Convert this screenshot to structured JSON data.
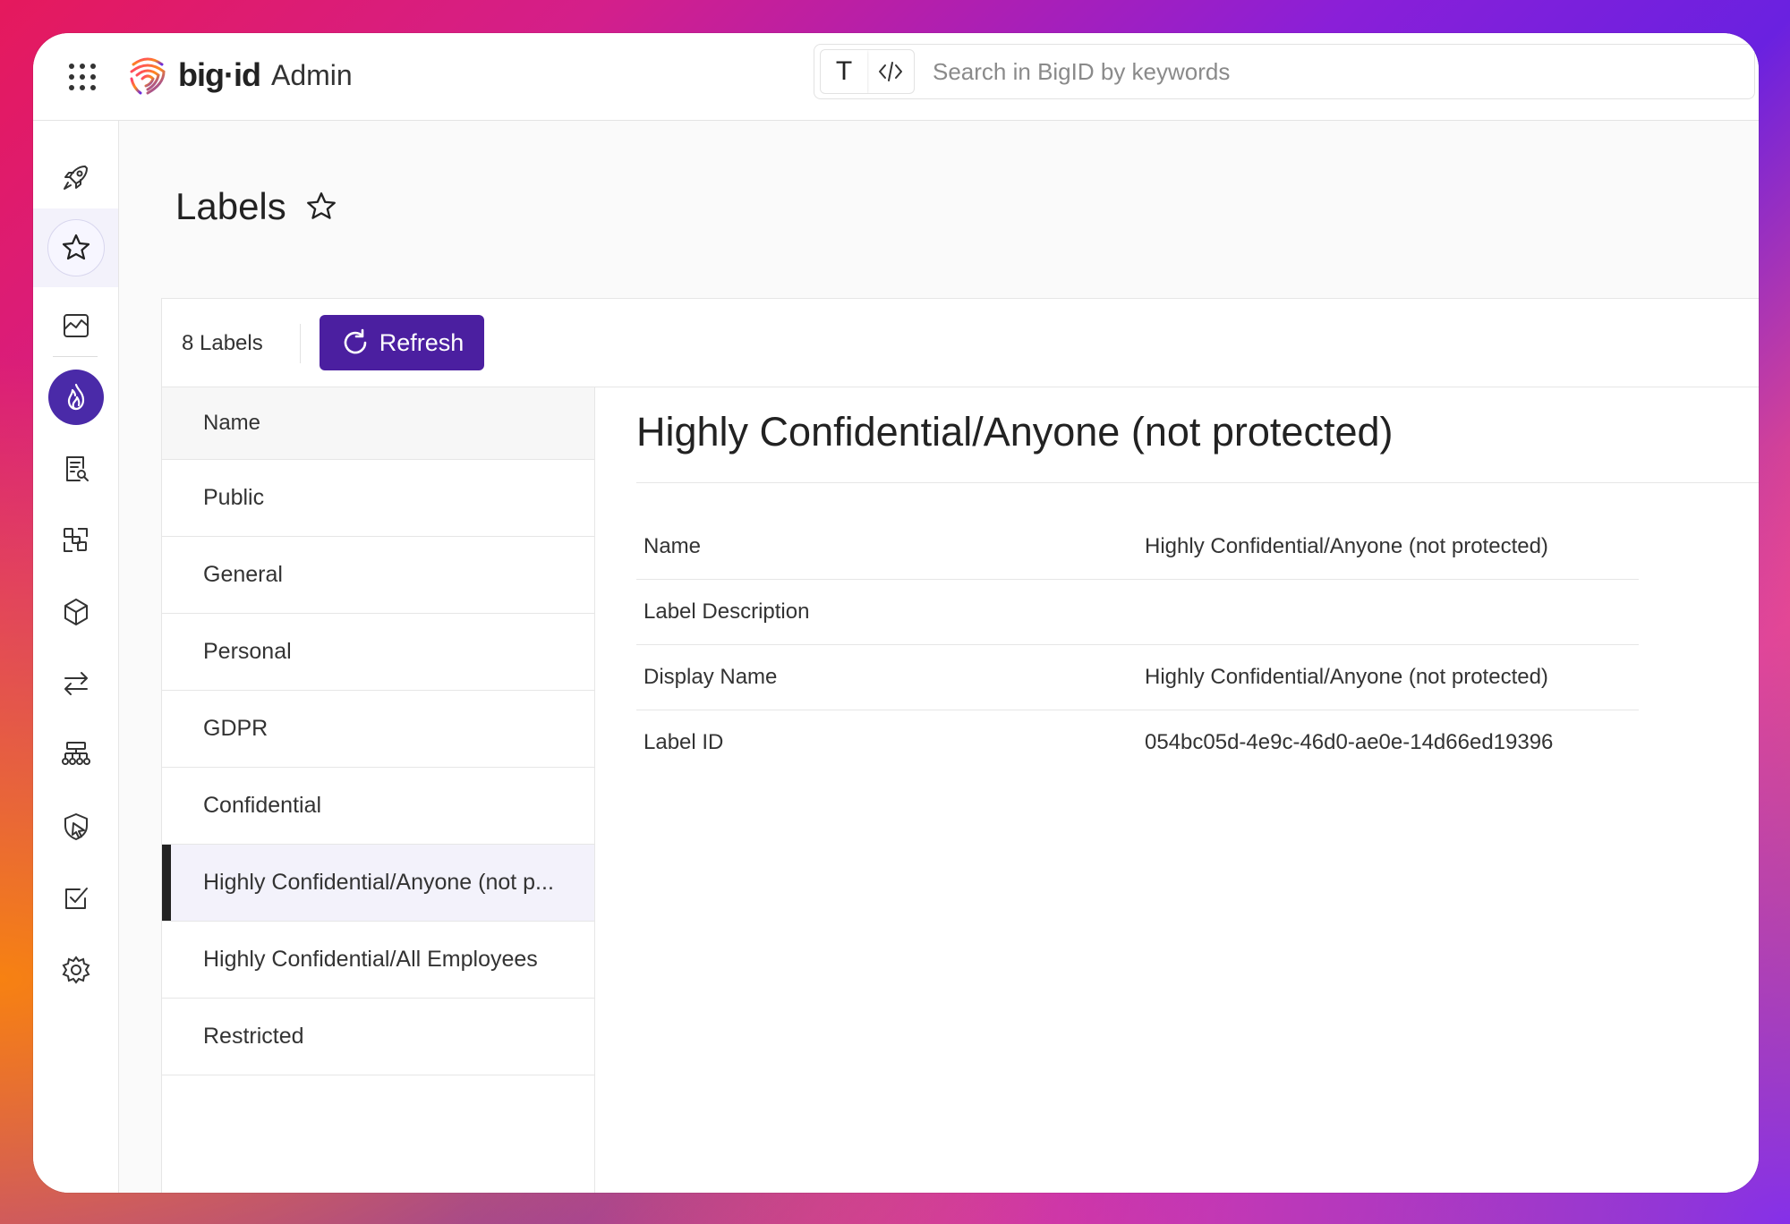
{
  "app": {
    "logo_text": "big·id",
    "product": "Admin"
  },
  "search": {
    "placeholder": "Search in BigID by keywords",
    "mode_text": "T",
    "mode_code": "</>"
  },
  "sidebar": {
    "items": [
      {
        "name": "rocket-icon"
      },
      {
        "name": "star-icon"
      },
      {
        "name": "chart-icon"
      },
      {
        "name": "fire-icon"
      },
      {
        "name": "document-search-icon"
      },
      {
        "name": "scan-icon"
      },
      {
        "name": "cube-icon"
      },
      {
        "name": "transfer-icon"
      },
      {
        "name": "hierarchy-icon"
      },
      {
        "name": "shield-cursor-icon"
      },
      {
        "name": "checkbox-icon"
      },
      {
        "name": "gear-icon"
      }
    ],
    "active": "fire-icon",
    "accent": "#4b1fa0"
  },
  "page": {
    "title": "Labels"
  },
  "toolbar": {
    "count_label": "8 Labels",
    "refresh_label": "Refresh"
  },
  "list": {
    "header": "Name",
    "rows": [
      "Public",
      "General",
      "Personal",
      "GDPR",
      "Confidential",
      "Highly Confidential/Anyone (not p...",
      "Highly Confidential/All Employees",
      "Restricted"
    ],
    "selected_index": 5
  },
  "detail": {
    "title": "Highly Confidential/Anyone (not protected)",
    "properties": [
      {
        "key": "Name",
        "value": "Highly Confidential/Anyone (not protected)"
      },
      {
        "key": "Label Description",
        "value": ""
      },
      {
        "key": "Display Name",
        "value": "Highly Confidential/Anyone (not protected)"
      },
      {
        "key": "Label ID",
        "value": "054bc05d-4e9c-46d0-ae0e-14d66ed19396"
      }
    ]
  }
}
